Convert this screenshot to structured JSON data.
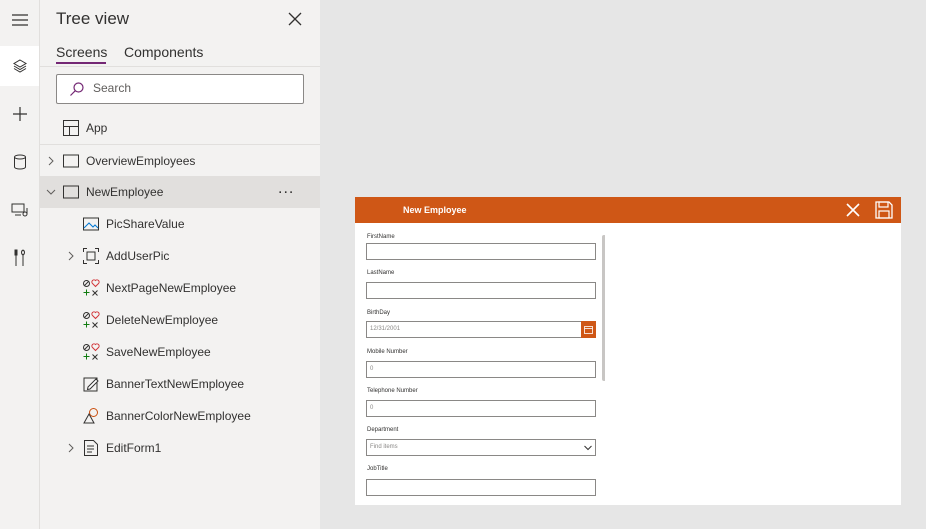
{
  "tree": {
    "title": "Tree view",
    "tabs": [
      "Screens",
      "Components"
    ],
    "search_placeholder": "Search",
    "app_label": "App",
    "screens": [
      {
        "label": "OverviewEmployees",
        "expanded": false
      },
      {
        "label": "NewEmployee",
        "expanded": true,
        "selected": true
      }
    ],
    "children": [
      {
        "label": "PicShareValue",
        "icon": "image-icon",
        "expandable": false
      },
      {
        "label": "AddUserPic",
        "icon": "add-picture-icon",
        "expandable": true
      },
      {
        "label": "NextPageNewEmployee",
        "icon": "icon-control-icon",
        "expandable": false
      },
      {
        "label": "DeleteNewEmployee",
        "icon": "icon-control-icon",
        "expandable": false
      },
      {
        "label": "SaveNewEmployee",
        "icon": "icon-control-icon",
        "expandable": false
      },
      {
        "label": "BannerTextNewEmployee",
        "icon": "text-label-icon",
        "expandable": false
      },
      {
        "label": "BannerColorNewEmployee",
        "icon": "shape-icon",
        "expandable": false
      },
      {
        "label": "EditForm1",
        "icon": "form-icon",
        "expandable": true
      }
    ],
    "more_label": "..."
  },
  "rail": {
    "icons": [
      "hamburger-icon",
      "layers-icon",
      "plus-icon",
      "database-icon",
      "media-icon",
      "tools-icon"
    ]
  },
  "screen": {
    "banner_title": "New Employee",
    "banner_color": "#cf5716",
    "fields": [
      {
        "label": "FirstName",
        "value": "",
        "type": "text"
      },
      {
        "label": "LastName",
        "value": "",
        "type": "text"
      },
      {
        "label": "BirthDay",
        "value": "12/31/2001",
        "type": "date"
      },
      {
        "label": "Mobile Number",
        "value": "0",
        "type": "text"
      },
      {
        "label": "Telephone Number",
        "value": "0",
        "type": "text"
      },
      {
        "label": "Department",
        "value": "Find items",
        "type": "dropdown"
      },
      {
        "label": "JobTitle",
        "value": "",
        "type": "text"
      }
    ]
  },
  "colors": {
    "accent": "#742774",
    "brand_orange": "#cf5716",
    "panel_bg": "#f3f2f1",
    "canvas_bg": "#e6e6e6"
  }
}
